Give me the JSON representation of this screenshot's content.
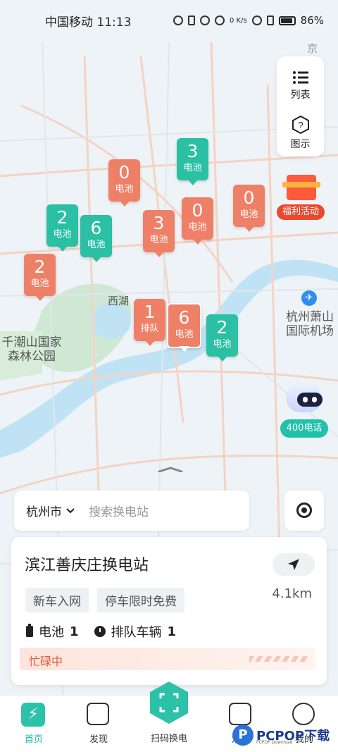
{
  "status_bar": {
    "carrier_time": "中国移动 11:13",
    "net_speed": "0 K/s",
    "battery": "86%"
  },
  "map_labels": {
    "xihu": "西湖",
    "forest_park": "千潮山国家\n森林公园",
    "airport": "杭州萧山\n国际机场",
    "jing": "京"
  },
  "side_panel": {
    "list_label": "列表",
    "legend_label": "图示"
  },
  "welfare": {
    "label": "福利活动"
  },
  "bot": {
    "label": "400电话"
  },
  "markers": [
    {
      "num": "0",
      "lbl": "电池",
      "color": "red"
    },
    {
      "num": "3",
      "lbl": "电池",
      "color": "green"
    },
    {
      "num": "2",
      "lbl": "电池",
      "color": "green"
    },
    {
      "num": "6",
      "lbl": "电池",
      "color": "green"
    },
    {
      "num": "3",
      "lbl": "电池",
      "color": "red"
    },
    {
      "num": "0",
      "lbl": "电池",
      "color": "red"
    },
    {
      "num": "0",
      "lbl": "电池",
      "color": "red"
    },
    {
      "num": "2",
      "lbl": "电池",
      "color": "red"
    },
    {
      "num": "1",
      "lbl": "排队",
      "color": "red"
    },
    {
      "num": "6",
      "lbl": "电池",
      "color": "red"
    },
    {
      "num": "2",
      "lbl": "电池",
      "color": "green"
    }
  ],
  "search": {
    "city": "杭州市",
    "placeholder": "搜索换电站"
  },
  "station": {
    "name": "滨江善庆庄换电站",
    "tags": [
      "新车入网",
      "停车限时免费"
    ],
    "distance": "4.1km",
    "battery_label": "电池",
    "battery_count": "1",
    "queue_label": "排队车辆",
    "queue_count": "1",
    "status": "忙碌中"
  },
  "tabbar": {
    "home": "首页",
    "discover": "发现",
    "scan": "扫码换电",
    "messages": "消息",
    "mine": "我的"
  },
  "watermark": {
    "brand": "PCPOP下载",
    "sub": "PCPOP Download"
  },
  "colors": {
    "accent": "#2bbfa4",
    "marker_red": "#ef8068",
    "busy": "#e05a36"
  }
}
